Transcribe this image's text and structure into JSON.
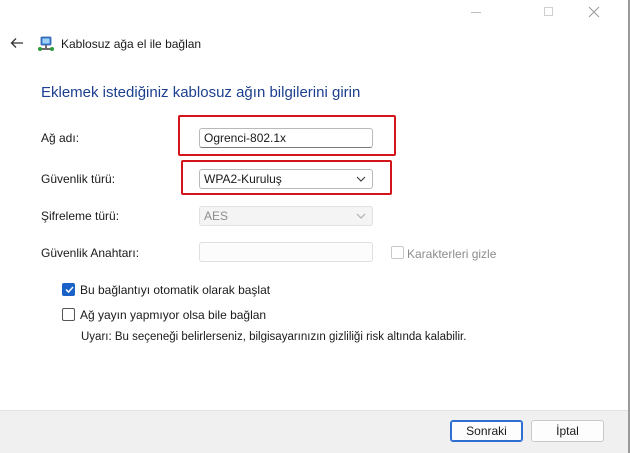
{
  "window": {
    "title": "Kablosuz ağa el ile bağlan"
  },
  "main": {
    "heading": "Eklemek istediğiniz kablosuz ağın bilgilerini girin"
  },
  "fields": {
    "network_name": {
      "label": "Ağ adı:",
      "value": "Ogrenci-802.1x"
    },
    "security_type": {
      "label": "Güvenlik türü:",
      "value": "WPA2-Kuruluş"
    },
    "encryption_type": {
      "label": "Şifreleme türü:",
      "value": "AES"
    },
    "security_key": {
      "label": "Güvenlik Anahtarı:",
      "value": ""
    },
    "hide_chars": {
      "label": "Karakterleri gizle",
      "checked": false
    }
  },
  "options": {
    "auto_start": {
      "label": "Bu bağlantıyı otomatik olarak başlat",
      "checked": true
    },
    "connect_hidden": {
      "label": "Ağ yayın yapmıyor olsa bile bağlan",
      "checked": false
    },
    "warning": "Uyarı: Bu seçeneği belirlerseniz, bilgisayarınızın gizliliği risk altında kalabilir."
  },
  "buttons": {
    "next": "Sonraki",
    "cancel": "İptal"
  },
  "colors": {
    "accent": "#1a62c7",
    "heading": "#1c3f8f",
    "highlight": "#d4141b"
  }
}
